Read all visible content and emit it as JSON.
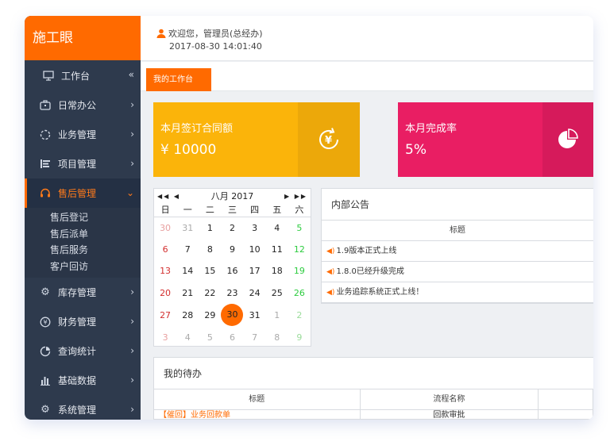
{
  "app": {
    "brand": "施工眼"
  },
  "sidebar": {
    "items": [
      {
        "label": "工作台",
        "icon": "monitor-icon"
      },
      {
        "label": "日常办公",
        "icon": "briefcase-icon"
      },
      {
        "label": "业务管理",
        "icon": "spinner-icon"
      },
      {
        "label": "项目管理",
        "icon": "list-icon"
      },
      {
        "label": "售后管理",
        "icon": "headset-icon",
        "active": true
      },
      {
        "label": "库存管理",
        "icon": "gear-icon"
      },
      {
        "label": "财务管理",
        "icon": "yen-circle-icon"
      },
      {
        "label": "查询统计",
        "icon": "pie-icon"
      },
      {
        "label": "基础数据",
        "icon": "bar-chart-icon"
      },
      {
        "label": "系统管理",
        "icon": "settings-icon"
      }
    ],
    "collapse_glyph": "«",
    "subitems": [
      "售后登记",
      "售后派单",
      "售后服务",
      "客户回访"
    ]
  },
  "header": {
    "welcome": "欢迎您，管理员(总经办)",
    "datetime": "2017-08-30 14:01:40"
  },
  "tabs": [
    {
      "label": "我的工作台"
    }
  ],
  "stats": [
    {
      "label": "本月签订合同额",
      "value": "¥ 10000",
      "color": "#fbb40a",
      "icon": "yen-refresh-icon"
    },
    {
      "label": "本月完成率",
      "value": "5%",
      "color": "#e91e63",
      "icon": "pie-chart-icon"
    }
  ],
  "calendar": {
    "title": "八月 2017",
    "weekdays": [
      "日",
      "一",
      "二",
      "三",
      "四",
      "五",
      "六"
    ],
    "weeks": [
      [
        "30",
        "31",
        "1",
        "2",
        "3",
        "4",
        "5"
      ],
      [
        "6",
        "7",
        "8",
        "9",
        "10",
        "11",
        "12"
      ],
      [
        "13",
        "14",
        "15",
        "16",
        "17",
        "18",
        "19"
      ],
      [
        "20",
        "21",
        "22",
        "23",
        "24",
        "25",
        "26"
      ],
      [
        "27",
        "28",
        "29",
        "30",
        "31",
        "1",
        "2"
      ],
      [
        "3",
        "4",
        "5",
        "6",
        "7",
        "8",
        "9"
      ]
    ],
    "today": "30"
  },
  "notice": {
    "title": "内部公告",
    "column": "标题",
    "rows": [
      "1.9版本正式上线",
      "1.8.0已经升级完成",
      "业务追踪系统正式上线！"
    ]
  },
  "todo": {
    "title": "我的待办",
    "columns": [
      "标题",
      "流程名称"
    ],
    "rows": [
      [
        "【催回】业务回款单",
        "回款审批"
      ]
    ]
  }
}
